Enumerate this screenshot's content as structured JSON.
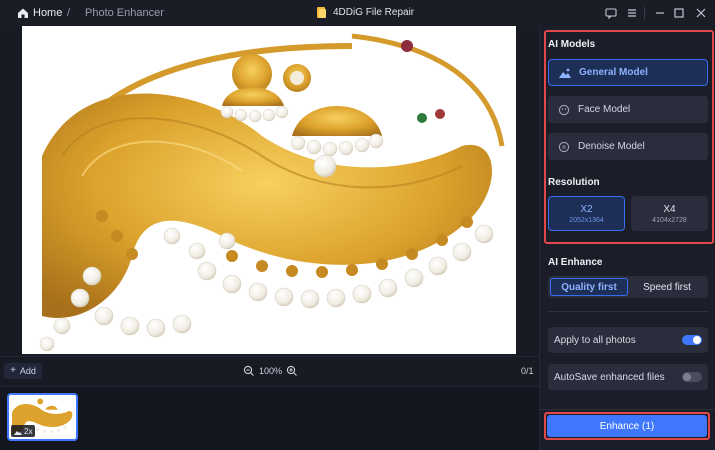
{
  "titlebar": {
    "home_label": "Home",
    "separator": "/",
    "page_label": "Photo Enhancer",
    "app_title": "4DDiG File Repair",
    "icons": [
      "feedback-icon",
      "menu-icon",
      "minimize-icon",
      "maximize-icon",
      "close-icon"
    ]
  },
  "zoombar": {
    "add_label": "Add",
    "zoom_level": "100%",
    "page_count": "0/1"
  },
  "thumbnails": [
    {
      "badge": "2x",
      "selected": true
    }
  ],
  "panel": {
    "ai_models_title": "AI Models",
    "models": [
      {
        "label": "General Model",
        "icon": "landscape-icon",
        "active": true
      },
      {
        "label": "Face Model",
        "icon": "face-icon",
        "active": false
      },
      {
        "label": "Denoise Model",
        "icon": "denoise-icon",
        "active": false
      }
    ],
    "resolution_title": "Resolution",
    "resolutions": [
      {
        "label": "X2",
        "size": "2052x1364",
        "active": true
      },
      {
        "label": "X4",
        "size": "4104x2728",
        "active": false
      }
    ],
    "ai_enhance_title": "AI Enhance",
    "enhance_modes": [
      {
        "label": "Quality first",
        "active": true
      },
      {
        "label": "Speed first",
        "active": false
      }
    ],
    "apply_all_label": "Apply to all photos",
    "apply_all_on": true,
    "autosave_label": "AutoSave enhanced files",
    "autosave_on": false,
    "enhance_button": "Enhance (1)"
  },
  "colors": {
    "accent": "#3f78ff",
    "highlight_border": "#e2474a",
    "panel_bg": "#1b1e29",
    "app_bg": "#14161f"
  }
}
